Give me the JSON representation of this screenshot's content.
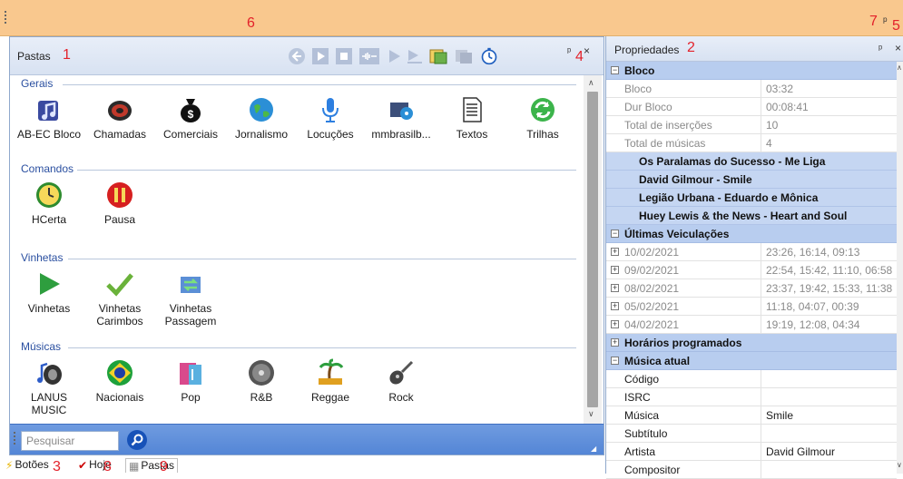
{
  "annotations": {
    "n1": "1",
    "n2": "2",
    "n3": "3",
    "n4": "4",
    "n5": "5",
    "n6": "6",
    "n7": "7",
    "n8": "8",
    "n9": "9"
  },
  "left_panel": {
    "title": "Pastas",
    "groups": [
      {
        "title": "Gerais",
        "items": [
          {
            "label": "AB-EC Bloco",
            "icon": "music-notes-icon"
          },
          {
            "label": "Chamadas",
            "icon": "speaker-icon"
          },
          {
            "label": "Comerciais",
            "icon": "money-bag-icon"
          },
          {
            "label": "Jornalismo",
            "icon": "globe-icon"
          },
          {
            "label": "Locuções",
            "icon": "microphone-icon"
          },
          {
            "label": "mmbrasilb...",
            "icon": "media-icon"
          },
          {
            "label": "Textos",
            "icon": "document-icon"
          },
          {
            "label": "Trilhas",
            "icon": "refresh-icon"
          }
        ]
      },
      {
        "title": "Comandos",
        "items": [
          {
            "label": "HCerta",
            "icon": "clock-icon"
          },
          {
            "label": "Pausa",
            "icon": "pause-icon"
          }
        ]
      },
      {
        "title": "Vinhetas",
        "items": [
          {
            "label": "Vinhetas",
            "icon": "play-icon"
          },
          {
            "label": "Vinhetas\nCarimbos",
            "icon": "checkmark-icon"
          },
          {
            "label": "Vinhetas\nPassagem",
            "icon": "transfer-icon"
          }
        ]
      },
      {
        "title": "Músicas",
        "items": [
          {
            "label": "LANUS\nMUSIC",
            "icon": "speaker-note-icon"
          },
          {
            "label": "Nacionais",
            "icon": "brazil-flag-icon"
          },
          {
            "label": "Pop",
            "icon": "pop-icon"
          },
          {
            "label": "R&B",
            "icon": "rnb-icon"
          },
          {
            "label": "Reggae",
            "icon": "palm-tree-icon"
          },
          {
            "label": "Rock",
            "icon": "guitar-icon"
          }
        ]
      }
    ]
  },
  "search": {
    "placeholder": "Pesquisar"
  },
  "bottom_tabs": {
    "tab1": "Botões",
    "tab2": "Hoje",
    "tab3": "Pastas"
  },
  "right_panel": {
    "title": "Propriedades",
    "bloco_section": "Bloco",
    "bloco_rows": [
      {
        "key": "Bloco",
        "value": "03:32"
      },
      {
        "key": "Dur Bloco",
        "value": "00:08:41"
      },
      {
        "key": "Total de inserções",
        "value": "10"
      },
      {
        "key": "Total de músicas",
        "value": "4"
      }
    ],
    "songs": [
      "Os Paralamas do Sucesso - Me Liga",
      "David Gilmour - Smile",
      "Legião Urbana - Eduardo e Mônica",
      "Huey Lewis & the News - Heart and Soul"
    ],
    "veic_section": "Últimas Veiculações",
    "veic_rows": [
      {
        "key": "10/02/2021",
        "value": "23:26, 16:14, 09:13"
      },
      {
        "key": "09/02/2021",
        "value": "22:54, 15:42, 11:10, 06:58"
      },
      {
        "key": "08/02/2021",
        "value": "23:37, 19:42, 15:33, 11:38"
      },
      {
        "key": "05/02/2021",
        "value": "11:18, 04:07, 00:39"
      },
      {
        "key": "04/02/2021",
        "value": "19:19, 12:08, 04:34"
      }
    ],
    "horarios_section": "Horários programados",
    "musica_section": "Música atual",
    "musica_rows": [
      {
        "key": "Código",
        "value": ""
      },
      {
        "key": "ISRC",
        "value": ""
      },
      {
        "key": "Música",
        "value": "Smile"
      },
      {
        "key": "Subtítulo",
        "value": ""
      },
      {
        "key": "Artista",
        "value": "David Gilmour"
      },
      {
        "key": "Compositor",
        "value": ""
      }
    ]
  },
  "colors": {
    "topbar": "#f9c88e",
    "accent": "#5486d6",
    "section": "#b8cdef",
    "group_title": "#2a4fa0",
    "annotation": "#e3222b"
  }
}
